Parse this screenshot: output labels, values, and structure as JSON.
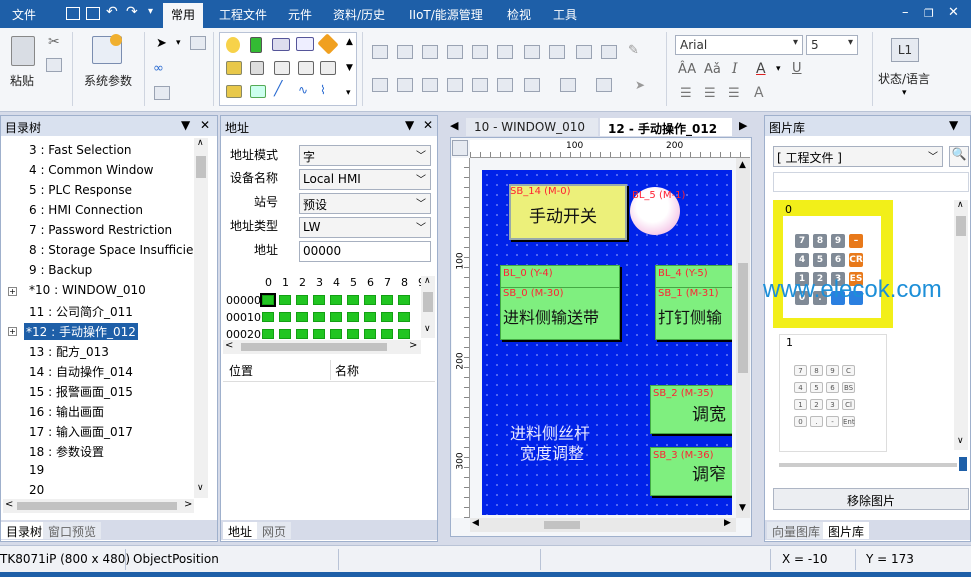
{
  "menubar": {
    "file": "文件",
    "tabs": [
      "常用",
      "工程文件",
      "元件",
      "资料/历史",
      "IIoT/能源管理",
      "检视",
      "工具"
    ],
    "active_tab": "常用"
  },
  "ribbon": {
    "paste_label": "粘贴",
    "sys_params_label": "系统参数",
    "font_name": "Arial",
    "font_size": "5",
    "lang_badge": "L1",
    "lang_label": "状态/语言"
  },
  "tree": {
    "title": "目录树",
    "items": [
      {
        "label": "3 : Fast Selection"
      },
      {
        "label": "4 : Common Window"
      },
      {
        "label": "5 : PLC Response"
      },
      {
        "label": "6 : HMI Connection"
      },
      {
        "label": "7 : Password Restriction"
      },
      {
        "label": "8 : Storage Space Insufficier"
      },
      {
        "label": "9 : Backup"
      },
      {
        "label": "*10 : WINDOW_010"
      },
      {
        "label": "11 : 公司简介_011"
      },
      {
        "label": "*12 : 手动操作_012"
      },
      {
        "label": "13 : 配方_013"
      },
      {
        "label": "14 : 自动操作_014"
      },
      {
        "label": "15 : 报警画面_015"
      },
      {
        "label": "16 : 输出画面"
      },
      {
        "label": "17 : 输入画面_017"
      },
      {
        "label": "18 : 参数设置"
      },
      {
        "label": "19"
      },
      {
        "label": "20"
      }
    ],
    "tab_tree": "目录树",
    "tab_preview": "窗口预览"
  },
  "address": {
    "title": "地址",
    "mode_label": "地址模式",
    "mode_value": "字",
    "device_label": "设备名称",
    "device_value": "Local HMI",
    "station_label": "站号",
    "station_value": "预设",
    "type_label": "地址类型",
    "type_value": "LW",
    "addr_label": "地址",
    "addr_value": "00000",
    "bit_cols": [
      "0",
      "1",
      "2",
      "3",
      "4",
      "5",
      "6",
      "7",
      "8",
      "9"
    ],
    "rows": [
      "00000",
      "00010",
      "00020"
    ],
    "col_position": "位置",
    "col_name": "名称",
    "tab_addr": "地址",
    "tab_web": "网页"
  },
  "canvas": {
    "tab1": "10 - WINDOW_010",
    "tab2": "12 - 手动操作_012",
    "ruler_100": "100",
    "ruler_200": "200",
    "vruler_100": "100",
    "vruler_200": "200",
    "vruler_300": "300",
    "sb14_tag": "SB_14 (M-0)",
    "sb14_text": "手动开关",
    "bl5_tag": "BL_5 (M-1)",
    "bl0_tag": "BL_0 (Y-4)",
    "sb0_tag": "SB_0 (M-30)",
    "sb0_text": "进料侧输送带",
    "bl4_tag": "BL_4 (Y-5)",
    "sb1_tag": "SB_1 (M-31)",
    "sb1_text": "打钉侧输",
    "sb2_tag": "SB_2 (M-35)",
    "sb2_text": "调宽",
    "sb3_tag": "SB_3 (M-36)",
    "sb3_text": "调窄",
    "label_line1": "进料侧丝杆",
    "label_line2": "宽度调整"
  },
  "gallery": {
    "title": "图片库",
    "category": "[ 工程文件 ]",
    "item0": "0",
    "item1": "1",
    "watermark": "www.elecok.com",
    "remove_btn": "移除图片",
    "tab_vector": "向量图库",
    "tab_picture": "图片库"
  },
  "status": {
    "model": "TK8071iP (800 x 480)",
    "object": "ObjectPosition",
    "x": "X = -10",
    "y": "Y = 173"
  },
  "colors": {
    "accent": "#1e5fa8",
    "hmi_bg": "#0022e8",
    "button_green": "#7fef7f",
    "button_yellow": "#ecf07a",
    "tag_red": "#f23",
    "lamp_green": "#21c521"
  }
}
